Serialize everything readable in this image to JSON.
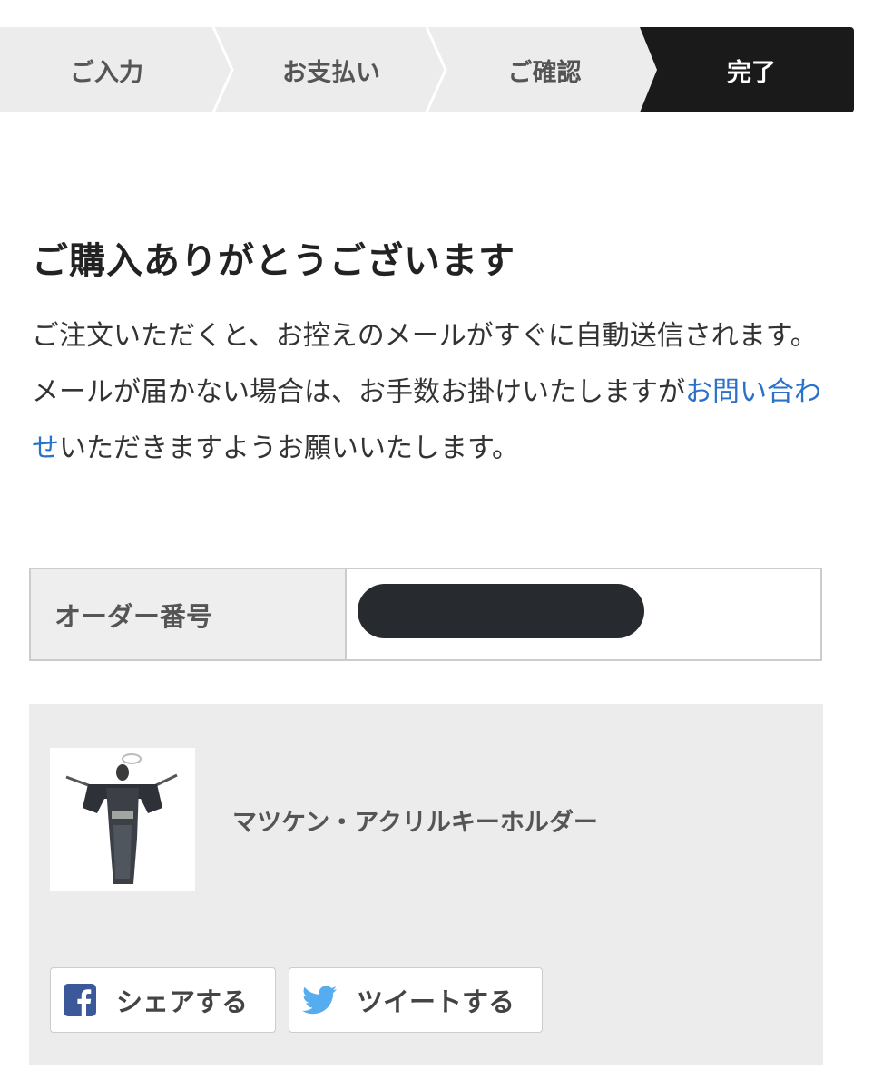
{
  "steps": [
    {
      "label": "ご入力",
      "active": false
    },
    {
      "label": "お支払い",
      "active": false
    },
    {
      "label": "ご確認",
      "active": false
    },
    {
      "label": "完了",
      "active": true
    }
  ],
  "page": {
    "title": "ご購入ありがとうございます",
    "message_part1": "ご注文いただくと、お控えのメールがすぐに自動送信されます。",
    "message_part2": "メールが届かない場合は、お手数お掛けいたしますが",
    "contact_link": "お問い合わせ",
    "message_part3": "いただきますようお願いいたします。"
  },
  "order": {
    "label": "オーダー番号",
    "number_redacted": true
  },
  "product": {
    "name": "マツケン・アクリルキーホルダー"
  },
  "share": {
    "facebook_label": "シェアする",
    "twitter_label": "ツイートする",
    "facebook_icon": "facebook-icon",
    "twitter_icon": "twitter-bird-icon"
  },
  "colors": {
    "active_step_bg": "#1a1a1a",
    "link": "#2a72c9",
    "facebook": "#3b5998",
    "twitter": "#55acee"
  }
}
